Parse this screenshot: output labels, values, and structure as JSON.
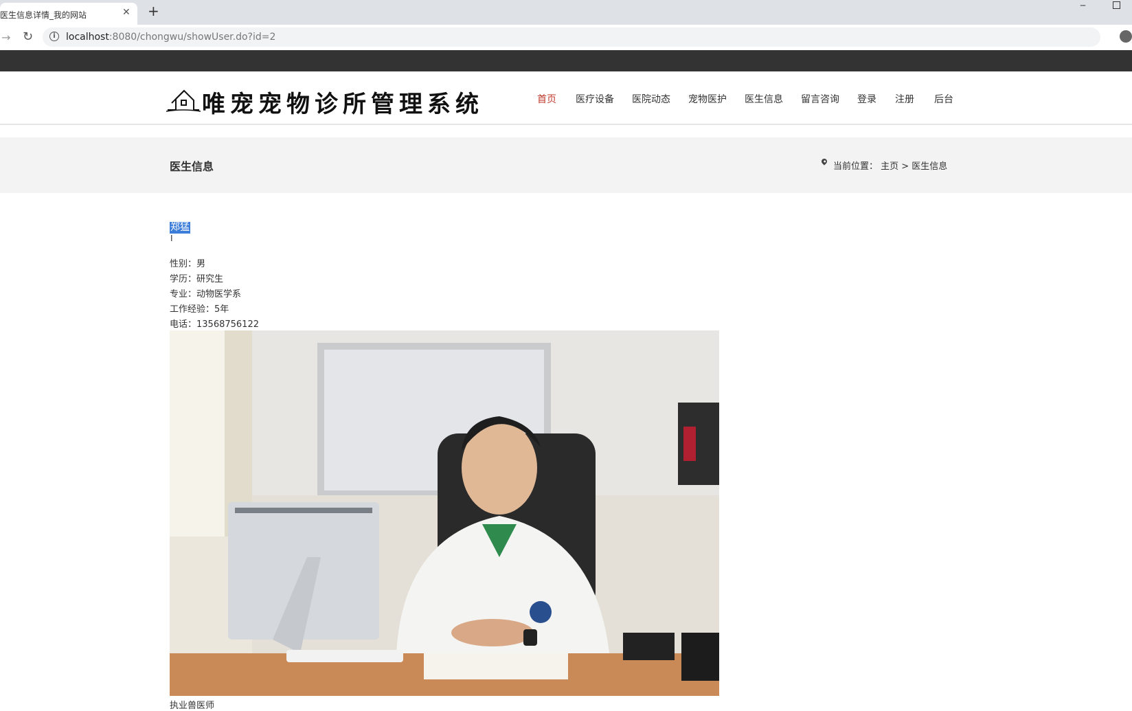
{
  "browser": {
    "tab_title": "医生信息详情_我的网站",
    "tab_close": "✕",
    "new_tab": "+",
    "minimize": "‒",
    "url_host": "localhost",
    "url_rest": ":8080/chongwu/showUser.do?id=2",
    "icons": {
      "forward": "arrow-right-icon",
      "reload": "reload-icon",
      "info": "info-icon",
      "star": "star-icon"
    }
  },
  "header": {
    "logo_text": "唯宠宠物诊所管理系统",
    "nav": [
      "首页",
      "医疗设备",
      "医院动态",
      "宠物医护",
      "医生信息",
      "留言咨询",
      "登录",
      "注册",
      "后台"
    ],
    "active_color": "#c0392b"
  },
  "banner": {
    "title": "医生信息",
    "breadcrumb": "当前位置： 主页 > 医生信息"
  },
  "doctor": {
    "name": "郑猛",
    "gender": "性别：男",
    "education": "学历：研究生",
    "major": "专业：动物医学系",
    "experience": "工作经验：5年",
    "phone": "电话：13568756122",
    "caption": "执业兽医师"
  }
}
